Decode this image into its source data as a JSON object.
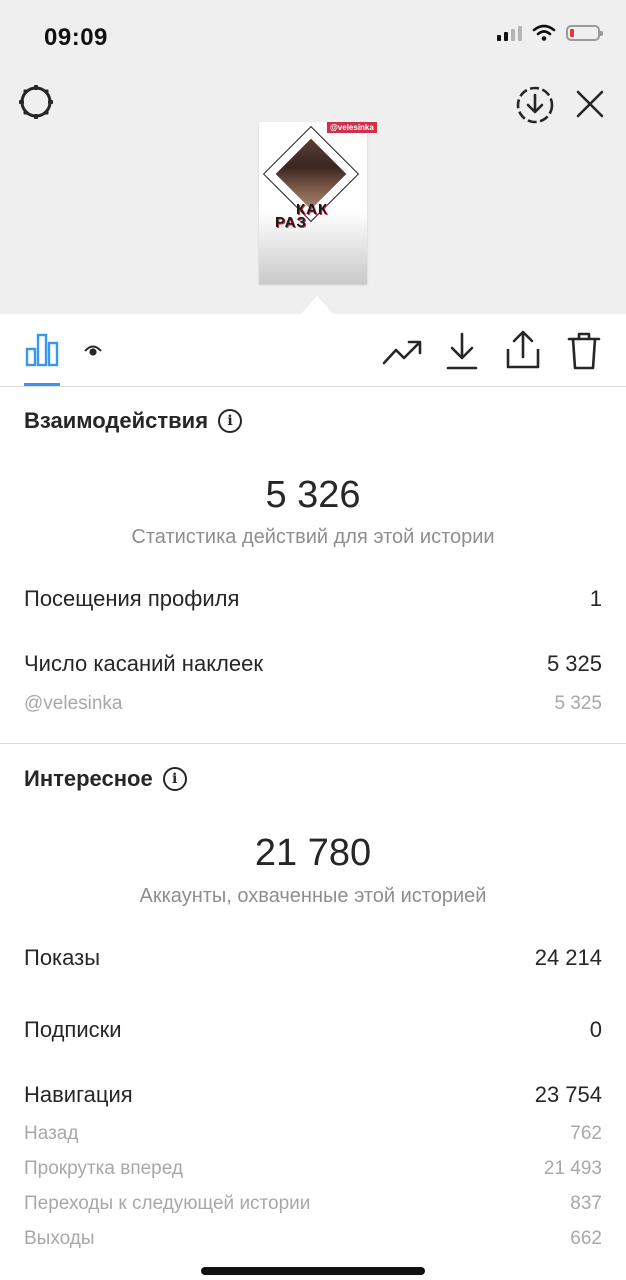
{
  "status_bar": {
    "time": "09:09"
  },
  "story_preview": {
    "handle": "@velesinka",
    "line1": "КАК",
    "line2": "РАЗ"
  },
  "colors": {
    "accent": "#3897f0",
    "battery_low": "#e53935",
    "sticker": "#d2304a"
  },
  "icons": {
    "top_left": "settings-gear-icon",
    "top_right": [
      "download-circle-icon",
      "close-icon"
    ],
    "tabs": [
      "bar-chart-icon",
      "eye-icon"
    ],
    "actions": [
      "trending-up-icon",
      "download-icon",
      "share-icon",
      "trash-icon"
    ]
  },
  "interactions": {
    "title": "Взаимодействия",
    "total": "5 326",
    "total_caption": "Статистика действий для этой истории",
    "rows": [
      {
        "label": "Посещения профиля",
        "value": "1"
      },
      {
        "label": "Число касаний наклеек",
        "value": "5 325"
      }
    ],
    "sub_rows": [
      {
        "label": "@velesinka",
        "value": "5 325"
      }
    ]
  },
  "discovery": {
    "title": "Интересное",
    "total": "21 780",
    "total_caption": "Аккаунты, охваченные этой историей",
    "rows": [
      {
        "label": "Показы",
        "value": "24 214"
      },
      {
        "label": "Подписки",
        "value": "0"
      },
      {
        "label": "Навигация",
        "value": "23 754"
      }
    ],
    "navigation_rows": [
      {
        "label": "Назад",
        "value": "762"
      },
      {
        "label": "Прокрутка вперед",
        "value": "21 493"
      },
      {
        "label": "Переходы к следующей истории",
        "value": "837"
      },
      {
        "label": "Выходы",
        "value": "662"
      }
    ]
  }
}
